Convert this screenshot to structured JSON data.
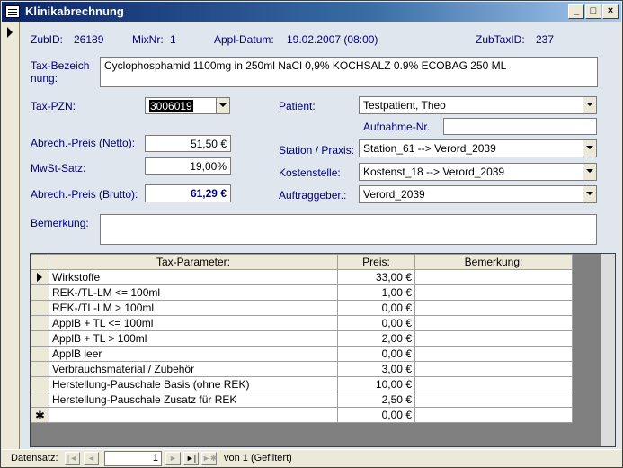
{
  "window": {
    "title": "Klinikabrechnung"
  },
  "header": {
    "zubid_label": "ZubID:",
    "zubid_value": "26189",
    "mixnr_label": "MixNr:",
    "mixnr_value": "1",
    "appl_datum_label": "Appl-Datum:",
    "appl_datum_value": "19.02.2007 (08:00)",
    "zubtaxid_label": "ZubTaxID:",
    "zubtaxid_value": "237"
  },
  "fields": {
    "tax_bez_label": "Tax-Bezeichnung:",
    "tax_bez_value": "Cyclophosphamid 1100mg in 250ml NaCl 0,9% KOCHSALZ 0.9% ECOBAG 250 ML",
    "tax_pzn_label": "Tax-PZN:",
    "tax_pzn_value": "3006019",
    "netto_label": "Abrech.-Preis (Netto):",
    "netto_value": "51,50 €",
    "mwst_label": "MwSt-Satz:",
    "mwst_value": "19,00%",
    "brutto_label": "Abrech.-Preis (Brutto):",
    "brutto_value": "61,29 €",
    "bemerkung_label": "Bemerkung:",
    "bemerkung_value": "",
    "patient_label": "Patient:",
    "patient_value": "Testpatient, Theo",
    "aufnahme_label": "Aufnahme-Nr.",
    "aufnahme_value": "",
    "station_label": "Station / Praxis:",
    "station_value": "Station_61 --> Verord_2039",
    "kostenstelle_label": "Kostenstelle:",
    "kostenstelle_value": "Kostenst_18 --> Verord_2039",
    "auftraggeber_label": "Auftraggeber.:",
    "auftraggeber_value": "Verord_2039"
  },
  "subtable": {
    "columns": [
      "Tax-Parameter:",
      "Preis:",
      "Bemerkung:"
    ],
    "rows": [
      {
        "param": "Wirkstoffe",
        "preis": "33,00 €",
        "bemerkung": ""
      },
      {
        "param": "REK-/TL-LM <= 100ml",
        "preis": "1,00 €",
        "bemerkung": ""
      },
      {
        "param": "REK-/TL-LM > 100ml",
        "preis": "0,00 €",
        "bemerkung": ""
      },
      {
        "param": "ApplB + TL <= 100ml",
        "preis": "0,00 €",
        "bemerkung": ""
      },
      {
        "param": "ApplB + TL > 100ml",
        "preis": "2,00 €",
        "bemerkung": ""
      },
      {
        "param": "ApplB leer",
        "preis": "0,00 €",
        "bemerkung": ""
      },
      {
        "param": "Verbrauchsmaterial / Zubehör",
        "preis": "3,00 €",
        "bemerkung": ""
      },
      {
        "param": "Herstellung-Pauschale Basis (ohne REK)",
        "preis": "10,00 €",
        "bemerkung": ""
      },
      {
        "param": "Herstellung-Pauschale Zusatz für REK",
        "preis": "2,50 €",
        "bemerkung": ""
      }
    ],
    "new_row_preis": "0,00 €",
    "new_row_marker": "✱"
  },
  "navigation": {
    "label": "Datensatz:",
    "current": "1",
    "of_text": "von  1 (Gefiltert)",
    "first": "|◄",
    "prev": "◄",
    "next": "►",
    "last": "►|",
    "new": "►✱"
  },
  "colors": {
    "label": "#00007b",
    "form_bg": "#dfe6ee",
    "title_gradient_start": "#0a246a"
  }
}
